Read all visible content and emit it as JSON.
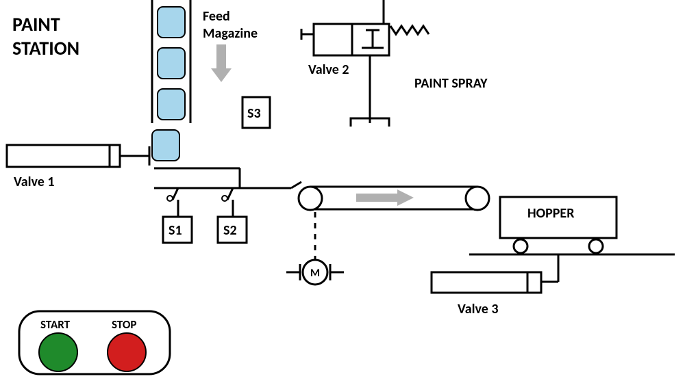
{
  "title_line1": "PAINT",
  "title_line2": "STATION",
  "feed_line1": "Feed",
  "feed_line2": "Magazine",
  "valve1": "Valve 1",
  "valve2": "Valve 2",
  "valve3": "Valve 3",
  "paint_spray": "PAINT SPRAY",
  "s1": "S1",
  "s2": "S2",
  "s3": "S3",
  "motor": "M",
  "hopper": "HOPPER",
  "start": "START",
  "stop": "STOP",
  "colors": {
    "part": "#a7d6ec",
    "start": "#1f8a2b",
    "stop": "#d21e1e",
    "arrow": "#b0b0b0"
  }
}
